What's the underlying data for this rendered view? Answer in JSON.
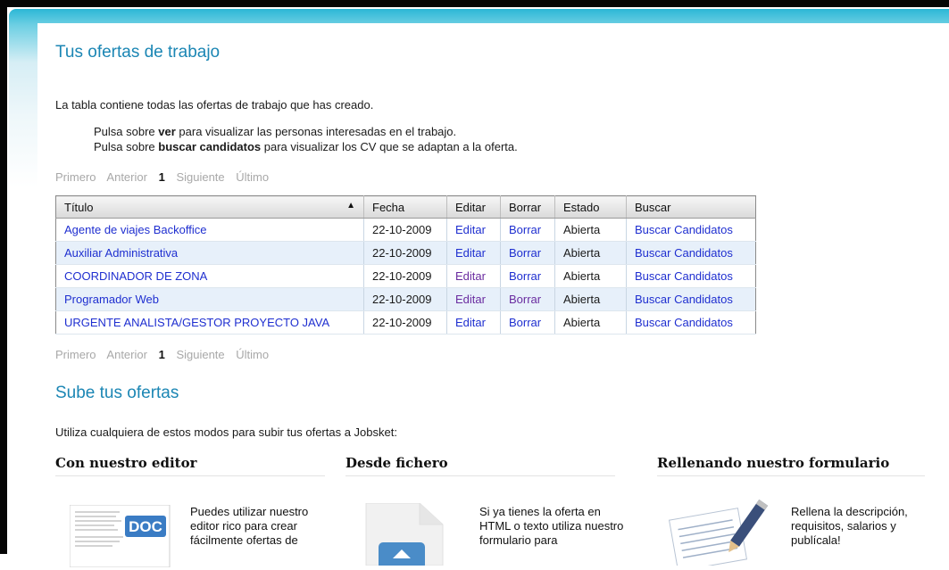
{
  "page": {
    "title": "Tus ofertas de trabajo",
    "intro": "La tabla contiene todas las ofertas de trabajo que has creado.",
    "bullet1": {
      "pre": "Pulsa sobre ",
      "bold": "ver",
      "post": " para visualizar las personas interesadas en el trabajo."
    },
    "bullet2": {
      "pre": "Pulsa sobre ",
      "bold": "buscar candidatos",
      "post": " para visualizar los CV que se adaptan a la oferta."
    }
  },
  "pager": {
    "first": "Primero",
    "prev": "Anterior",
    "current": "1",
    "next": "Siguiente",
    "last": "Último"
  },
  "table": {
    "headers": {
      "title": "Título",
      "date": "Fecha",
      "edit": "Editar",
      "delete": "Borrar",
      "status": "Estado",
      "search": "Buscar"
    },
    "rows": [
      {
        "title": "Agente de viajes Backoffice",
        "date": "22-10-2009",
        "edit": "Editar",
        "delete": "Borrar",
        "status": "Abierta",
        "search": "Buscar Candidatos"
      },
      {
        "title": "Auxiliar Administrativa",
        "date": "22-10-2009",
        "edit": "Editar",
        "delete": "Borrar",
        "status": "Abierta",
        "search": "Buscar Candidatos"
      },
      {
        "title": "COORDINADOR DE ZONA",
        "date": "22-10-2009",
        "edit": "Editar",
        "delete": "Borrar",
        "status": "Abierta",
        "search": "Buscar Candidatos"
      },
      {
        "title": "Programador Web",
        "date": "22-10-2009",
        "edit": "Editar",
        "delete": "Borrar",
        "status": "Abierta",
        "search": "Buscar Candidatos"
      },
      {
        "title": "URGENTE ANALISTA/GESTOR PROYECTO JAVA",
        "date": "22-10-2009",
        "edit": "Editar",
        "delete": "Borrar",
        "status": "Abierta",
        "search": "Buscar Candidatos"
      }
    ]
  },
  "upload": {
    "title": "Sube tus ofertas",
    "intro": "Utiliza cualquiera de estos modos para subir tus ofertas a Jobsket:",
    "editor": {
      "title": "Con nuestro editor",
      "text": "Puedes utilizar nuestro editor rico para crear fácilmente ofertas de",
      "icon_label": "DOC"
    },
    "file": {
      "title": "Desde fichero",
      "text": "Si ya tienes la oferta en HTML o texto utiliza nuestro formulario para"
    },
    "form": {
      "title": "Rellenando nuestro formulario",
      "text": "Rellena la descripción, requisitos, salarios y publícala!"
    }
  },
  "colors": {
    "accent": "#1b86b4",
    "link": "#1f2fd0",
    "row_alt": "#e7f0fa"
  },
  "icons": {
    "doc": "doc-icon",
    "file": "file-upload-icon",
    "form": "form-pencil-icon",
    "sort": "sort-asc-icon"
  }
}
